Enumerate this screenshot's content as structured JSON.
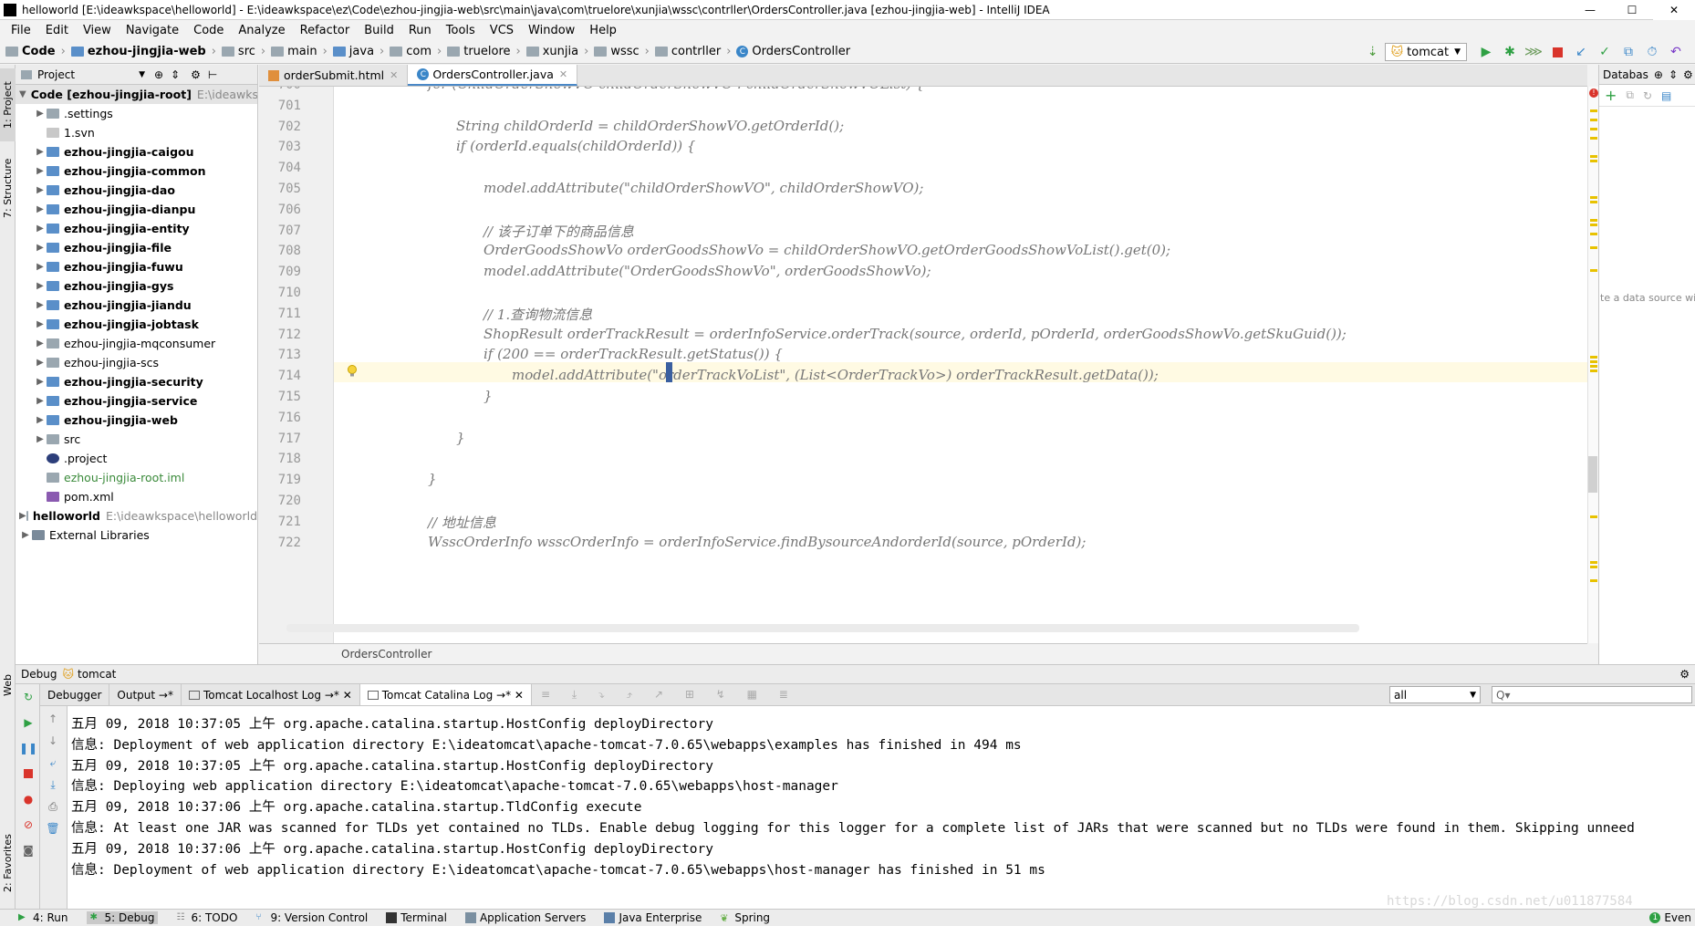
{
  "window": {
    "title": "helloworld [E:\\ideawkspace\\helloworld] - E:\\ideawkspace\\ez\\Code\\ezhou-jingjia-web\\src\\main\\java\\com\\truelore\\xunjia\\wssc\\contrller\\OrdersController.java [ezhou-jingjia-web] - IntelliJ IDEA",
    "minimize": "—",
    "maximize": "☐",
    "close": "✕"
  },
  "menu": [
    "File",
    "Edit",
    "View",
    "Navigate",
    "Code",
    "Analyze",
    "Refactor",
    "Build",
    "Run",
    "Tools",
    "VCS",
    "Window",
    "Help"
  ],
  "breadcrumbs": [
    "Code",
    "ezhou-jingjia-web",
    "src",
    "main",
    "java",
    "com",
    "truelore",
    "xunjia",
    "wssc",
    "contrller",
    "OrdersController"
  ],
  "run_config": "tomcat",
  "project_panel": {
    "title": "Project",
    "tree": [
      {
        "label": "Code [ezhou-jingjia-root]",
        "extra": "E:\\ideawks",
        "indent": 0,
        "bold": true,
        "arrow": "▼",
        "icon": "folder"
      },
      {
        "label": ".settings",
        "indent": 1,
        "bold": false,
        "arrow": "▶",
        "icon": "folder"
      },
      {
        "label": "1.svn",
        "indent": 1,
        "bold": false,
        "arrow": "",
        "icon": "file"
      },
      {
        "label": "ezhou-jingjia-caigou",
        "indent": 1,
        "bold": true,
        "arrow": "▶",
        "icon": "module"
      },
      {
        "label": "ezhou-jingjia-common",
        "indent": 1,
        "bold": true,
        "arrow": "▶",
        "icon": "module"
      },
      {
        "label": "ezhou-jingjia-dao",
        "indent": 1,
        "bold": true,
        "arrow": "▶",
        "icon": "module"
      },
      {
        "label": "ezhou-jingjia-dianpu",
        "indent": 1,
        "bold": true,
        "arrow": "▶",
        "icon": "module"
      },
      {
        "label": "ezhou-jingjia-entity",
        "indent": 1,
        "bold": true,
        "arrow": "▶",
        "icon": "module"
      },
      {
        "label": "ezhou-jingjia-file",
        "indent": 1,
        "bold": true,
        "arrow": "▶",
        "icon": "module"
      },
      {
        "label": "ezhou-jingjia-fuwu",
        "indent": 1,
        "bold": true,
        "arrow": "▶",
        "icon": "module"
      },
      {
        "label": "ezhou-jingjia-gys",
        "indent": 1,
        "bold": true,
        "arrow": "▶",
        "icon": "module"
      },
      {
        "label": "ezhou-jingjia-jiandu",
        "indent": 1,
        "bold": true,
        "arrow": "▶",
        "icon": "module"
      },
      {
        "label": "ezhou-jingjia-jobtask",
        "indent": 1,
        "bold": true,
        "arrow": "▶",
        "icon": "module"
      },
      {
        "label": "ezhou-jingjia-mqconsumer",
        "indent": 1,
        "bold": false,
        "arrow": "▶",
        "icon": "folder"
      },
      {
        "label": "ezhou-jingjia-scs",
        "indent": 1,
        "bold": false,
        "arrow": "▶",
        "icon": "folder"
      },
      {
        "label": "ezhou-jingjia-security",
        "indent": 1,
        "bold": true,
        "arrow": "▶",
        "icon": "module"
      },
      {
        "label": "ezhou-jingjia-service",
        "indent": 1,
        "bold": true,
        "arrow": "▶",
        "icon": "module"
      },
      {
        "label": "ezhou-jingjia-web",
        "indent": 1,
        "bold": true,
        "arrow": "▶",
        "icon": "module"
      },
      {
        "label": "src",
        "indent": 1,
        "bold": false,
        "arrow": "▶",
        "icon": "folder"
      },
      {
        "label": ".project",
        "indent": 1,
        "bold": false,
        "arrow": "",
        "icon": "eclipse"
      },
      {
        "label": "ezhou-jingjia-root.iml",
        "indent": 1,
        "bold": false,
        "arrow": "",
        "icon": "iml",
        "green": true
      },
      {
        "label": "pom.xml",
        "indent": 1,
        "bold": false,
        "arrow": "",
        "icon": "maven"
      },
      {
        "label": "helloworld",
        "extra": "E:\\ideawkspace\\helloworld",
        "indent": 0,
        "bold": true,
        "arrow": "▶",
        "icon": "folder"
      },
      {
        "label": "External Libraries",
        "indent": 0,
        "bold": false,
        "arrow": "▶",
        "icon": "lib"
      }
    ]
  },
  "editor_tabs": [
    {
      "label": "orderSubmit.html",
      "active": false
    },
    {
      "label": "OrdersController.java",
      "active": true
    }
  ],
  "code": [
    {
      "num": "700",
      "text": "for (ChildOrderShowVO childOrderShowVO : childOrderShowVOList) {",
      "indent": 0
    },
    {
      "num": "701",
      "text": "",
      "indent": 0
    },
    {
      "num": "702",
      "text": "String childOrderId = childOrderShowVO.getOrderId();",
      "indent": 1
    },
    {
      "num": "703",
      "text": "if (orderId.equals(childOrderId)) {",
      "indent": 1
    },
    {
      "num": "704",
      "text": "",
      "indent": 0
    },
    {
      "num": "705",
      "text": "model.addAttribute(\"childOrderShowVO\", childOrderShowVO);",
      "indent": 2
    },
    {
      "num": "706",
      "text": "",
      "indent": 0
    },
    {
      "num": "707",
      "text": "// 该子订单下的商品信息",
      "indent": 2
    },
    {
      "num": "708",
      "text": "OrderGoodsShowVo orderGoodsShowVo = childOrderShowVO.getOrderGoodsShowVoList().get(0);",
      "indent": 2
    },
    {
      "num": "709",
      "text": "model.addAttribute(\"OrderGoodsShowVo\", orderGoodsShowVo);",
      "indent": 2
    },
    {
      "num": "710",
      "text": "",
      "indent": 0
    },
    {
      "num": "711",
      "text": "// 1.查询物流信息",
      "indent": 2
    },
    {
      "num": "712",
      "text": "ShopResult orderTrackResult = orderInfoService.orderTrack(source, orderId, pOrderId, orderGoodsShowVo.getSkuGuid());",
      "indent": 2
    },
    {
      "num": "713",
      "text": "if (200 == orderTrackResult.getStatus()) {",
      "indent": 2
    },
    {
      "num": "714",
      "text": "model.addAttribute(\"orderTrackVoList\", (List<OrderTrackVo>) orderTrackResult.getData());",
      "indent": 3
    },
    {
      "num": "715",
      "text": "}",
      "indent": 2
    },
    {
      "num": "716",
      "text": "",
      "indent": 0
    },
    {
      "num": "717",
      "text": "}",
      "indent": 1
    },
    {
      "num": "718",
      "text": "",
      "indent": 0
    },
    {
      "num": "719",
      "text": "}",
      "indent": 0
    },
    {
      "num": "720",
      "text": "",
      "indent": 0
    },
    {
      "num": "721",
      "text": "// 地址信息",
      "indent": 0
    },
    {
      "num": "722",
      "text": "WsscOrderInfo wsscOrderInfo = orderInfoService.findBysourceAndorderId(source, pOrderId);",
      "indent": 0
    }
  ],
  "structure_bar": "OrdersController",
  "db_panel": {
    "title": "Databas",
    "hint": "te a data source wit"
  },
  "debug": {
    "title": "Debug",
    "config": "tomcat",
    "tabs": [
      {
        "label": "Debugger",
        "active": false
      },
      {
        "label": "Output →*",
        "active": false
      },
      {
        "label": "Tomcat Localhost Log →* ✕",
        "active": false
      },
      {
        "label": "Tomcat Catalina Log →* ✕",
        "active": true
      }
    ],
    "filter": "all",
    "search_placeholder": "Q▾",
    "log": [
      "五月 09, 2018 10:37:05 上午 org.apache.catalina.startup.HostConfig deployDirectory",
      "信息: Deployment of web application directory E:\\ideatomcat\\apache-tomcat-7.0.65\\webapps\\examples has finished in 494 ms",
      "五月 09, 2018 10:37:05 上午 org.apache.catalina.startup.HostConfig deployDirectory",
      "信息: Deploying web application directory E:\\ideatomcat\\apache-tomcat-7.0.65\\webapps\\host-manager",
      "五月 09, 2018 10:37:06 上午 org.apache.catalina.startup.TldConfig execute",
      "信息: At least one JAR was scanned for TLDs yet contained no TLDs. Enable debug logging for this logger for a complete list of JARs that were scanned but no TLDs were found in them. Skipping unneed",
      "五月 09, 2018 10:37:06 上午 org.apache.catalina.startup.HostConfig deployDirectory",
      "信息: Deployment of web application directory E:\\ideatomcat\\apache-tomcat-7.0.65\\webapps\\host-manager has finished in 51 ms"
    ]
  },
  "left_strip": {
    "project": "1: Project",
    "structure": "7: Structure",
    "web": "Web",
    "favorites": "2: Favorites"
  },
  "statusbar": [
    {
      "label": "4: Run",
      "active": false
    },
    {
      "label": "5: Debug",
      "active": true
    },
    {
      "label": "6: TODO",
      "active": false
    },
    {
      "label": "9: Version Control",
      "active": false
    },
    {
      "label": "Terminal",
      "active": false
    },
    {
      "label": "Application Servers",
      "active": false
    },
    {
      "label": "Java Enterprise",
      "active": false
    },
    {
      "label": "Spring",
      "active": false
    }
  ],
  "event_log": "Even",
  "event_count": "1",
  "watermark": "https://blog.csdn.net/u011877584",
  "colors": {
    "accent": "#4a88c7",
    "highlight_line": "#fffae3",
    "stripe": "#e8c200",
    "run_green": "#2ea043",
    "stop_red": "#d9342b"
  }
}
